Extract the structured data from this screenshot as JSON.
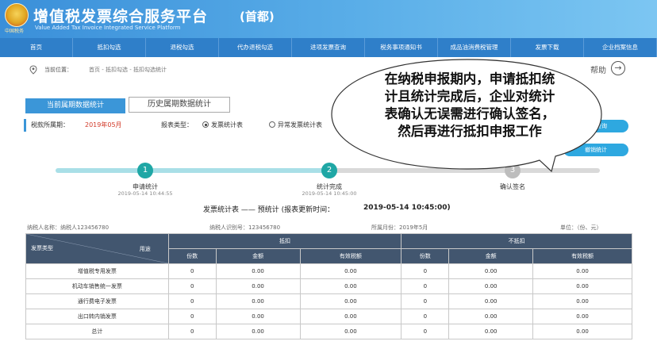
{
  "header": {
    "title": "增值税发票综合服务平台",
    "subtitle": "Value Added Tax Invoice Integrated Service Platform",
    "region": "(首都)",
    "emblem_text": "中国税务"
  },
  "nav": [
    "首页",
    "抵扣勾选",
    "退税勾选",
    "代办退税勾选",
    "进项发票查询",
    "税务事项通知书",
    "成品油消费税管理",
    "发票下载",
    "企业档案信息"
  ],
  "breadcrumb": {
    "label": "当前位置：",
    "path": "首页 - 抵扣勾选 - 抵扣勾选统计",
    "help": "帮助"
  },
  "tabs": {
    "current": "当前属期数据统计",
    "history": "历史属期数据统计"
  },
  "period": {
    "label": "税款所属期：",
    "value": "2019年05月",
    "report_type_label": "报表类型：",
    "options": [
      "发票统计表",
      "异常发票统计表"
    ],
    "selected": 0
  },
  "side_buttons": [
    "统计查询",
    "撤销统计"
  ],
  "steps": [
    {
      "num": "1",
      "label": "申请统计",
      "time": "2019-05-14 10:44:55",
      "state": "done"
    },
    {
      "num": "2",
      "label": "统计完成",
      "time": "2019-05-14 10:45:00",
      "state": "done"
    },
    {
      "num": "3",
      "label": "确认签名",
      "time": "",
      "state": "todo"
    }
  ],
  "stats": {
    "title": "发票统计表 —— 预统计 (报表更新时间：",
    "time": "2019-05-14 10:45:00)"
  },
  "info": {
    "taxpayer_name": "纳税人名称：纳税人123456780",
    "taxpayer_id": "纳税人识别号：123456780",
    "month": "所属月份：2019年5月",
    "unit": "单位：（份、元）"
  },
  "table": {
    "corner_top": "用途",
    "corner_bottom": "发票类型",
    "group_deduct": "抵扣",
    "group_nondeduct": "不抵扣",
    "sub_headers": [
      "份数",
      "金额",
      "有效税额",
      "份数",
      "金额",
      "有效税额"
    ],
    "rows": [
      {
        "type": "增值税专用发票",
        "values": [
          "0",
          "0.00",
          "0.00",
          "0",
          "0.00",
          "0.00"
        ]
      },
      {
        "type": "机动车销售统一发票",
        "values": [
          "0",
          "0.00",
          "0.00",
          "0",
          "0.00",
          "0.00"
        ]
      },
      {
        "type": "通行费电子发票",
        "values": [
          "0",
          "0.00",
          "0.00",
          "0",
          "0.00",
          "0.00"
        ]
      },
      {
        "type": "出口转内销发票",
        "values": [
          "0",
          "0.00",
          "0.00",
          "0",
          "0.00",
          "0.00"
        ]
      },
      {
        "type": "总计",
        "values": [
          "0",
          "0.00",
          "0.00",
          "0",
          "0.00",
          "0.00"
        ]
      }
    ]
  },
  "bubble": {
    "lines": [
      "在纳税申报期内，申请抵扣统",
      "计且统计完成后，企业对统计",
      "表确认无误需进行确认签名，",
      "然后再进行抵扣申报工作"
    ]
  },
  "colors": {
    "header_blue": "#3a8fd9",
    "nav_blue": "#2f7fc9",
    "step_done": "#1fa7a5",
    "step_todo": "#bdbdbd",
    "table_header": "#42566f",
    "period_red": "#d23b2a"
  }
}
